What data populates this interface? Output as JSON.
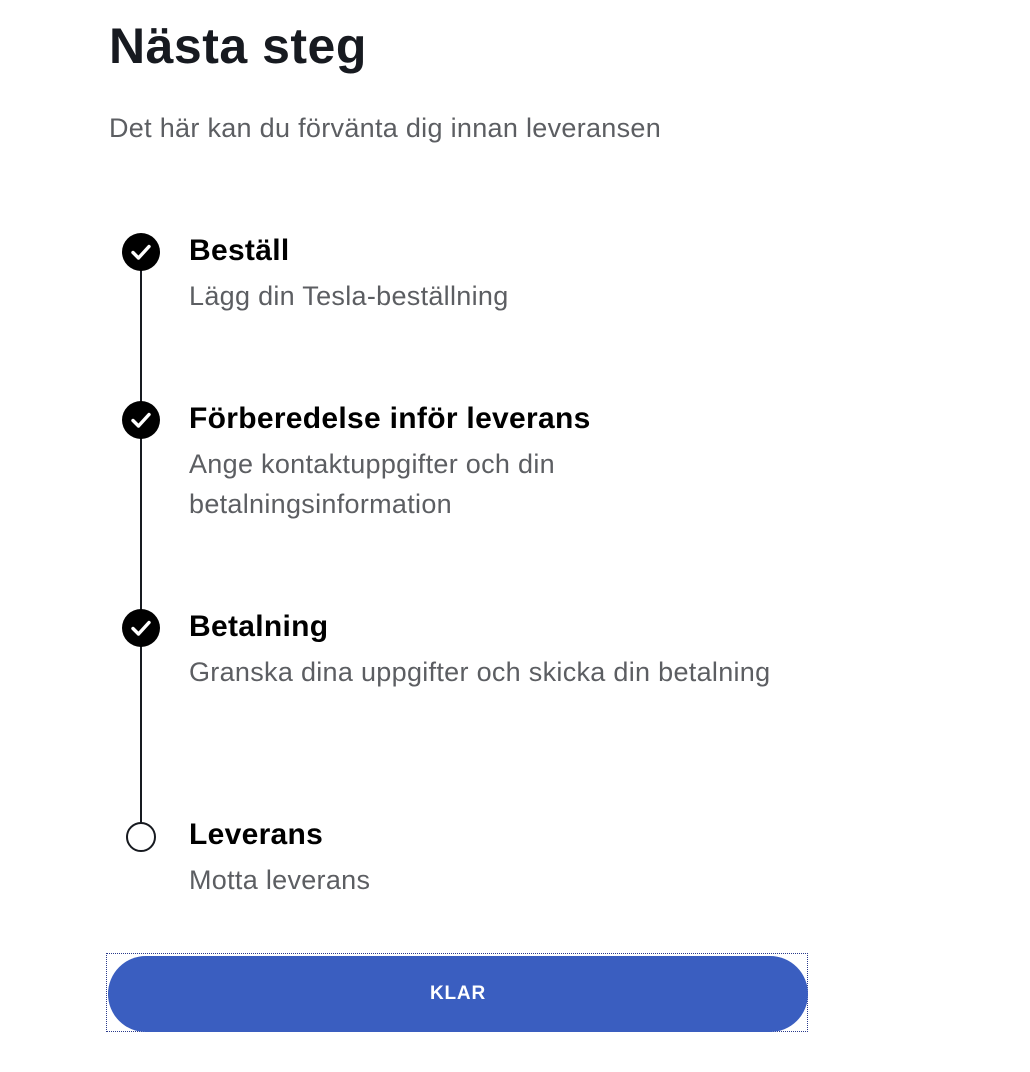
{
  "header": {
    "title": "Nästa steg",
    "subtitle": "Det här kan du förvänta dig innan leveransen"
  },
  "steps": [
    {
      "title": "Beställ",
      "description": "Lägg din Tesla-beställning",
      "status": "completed",
      "icon": "check-circle-icon"
    },
    {
      "title": "Förberedelse inför leverans",
      "description": "Ange kontaktuppgifter och din betalningsinformation",
      "status": "completed",
      "icon": "check-circle-icon"
    },
    {
      "title": "Betalning",
      "description": "Granska dina uppgifter och skicka din betalning",
      "status": "completed",
      "icon": "check-circle-icon"
    },
    {
      "title": "Leverans",
      "description": "Motta leverans",
      "status": "pending",
      "icon": "empty-circle-icon"
    }
  ],
  "actions": {
    "done_label": "KLAR"
  },
  "colors": {
    "primary_button": "#3a5ec0",
    "text_primary": "#171a20",
    "text_secondary": "#5c5e62",
    "marker_done": "#000000"
  }
}
